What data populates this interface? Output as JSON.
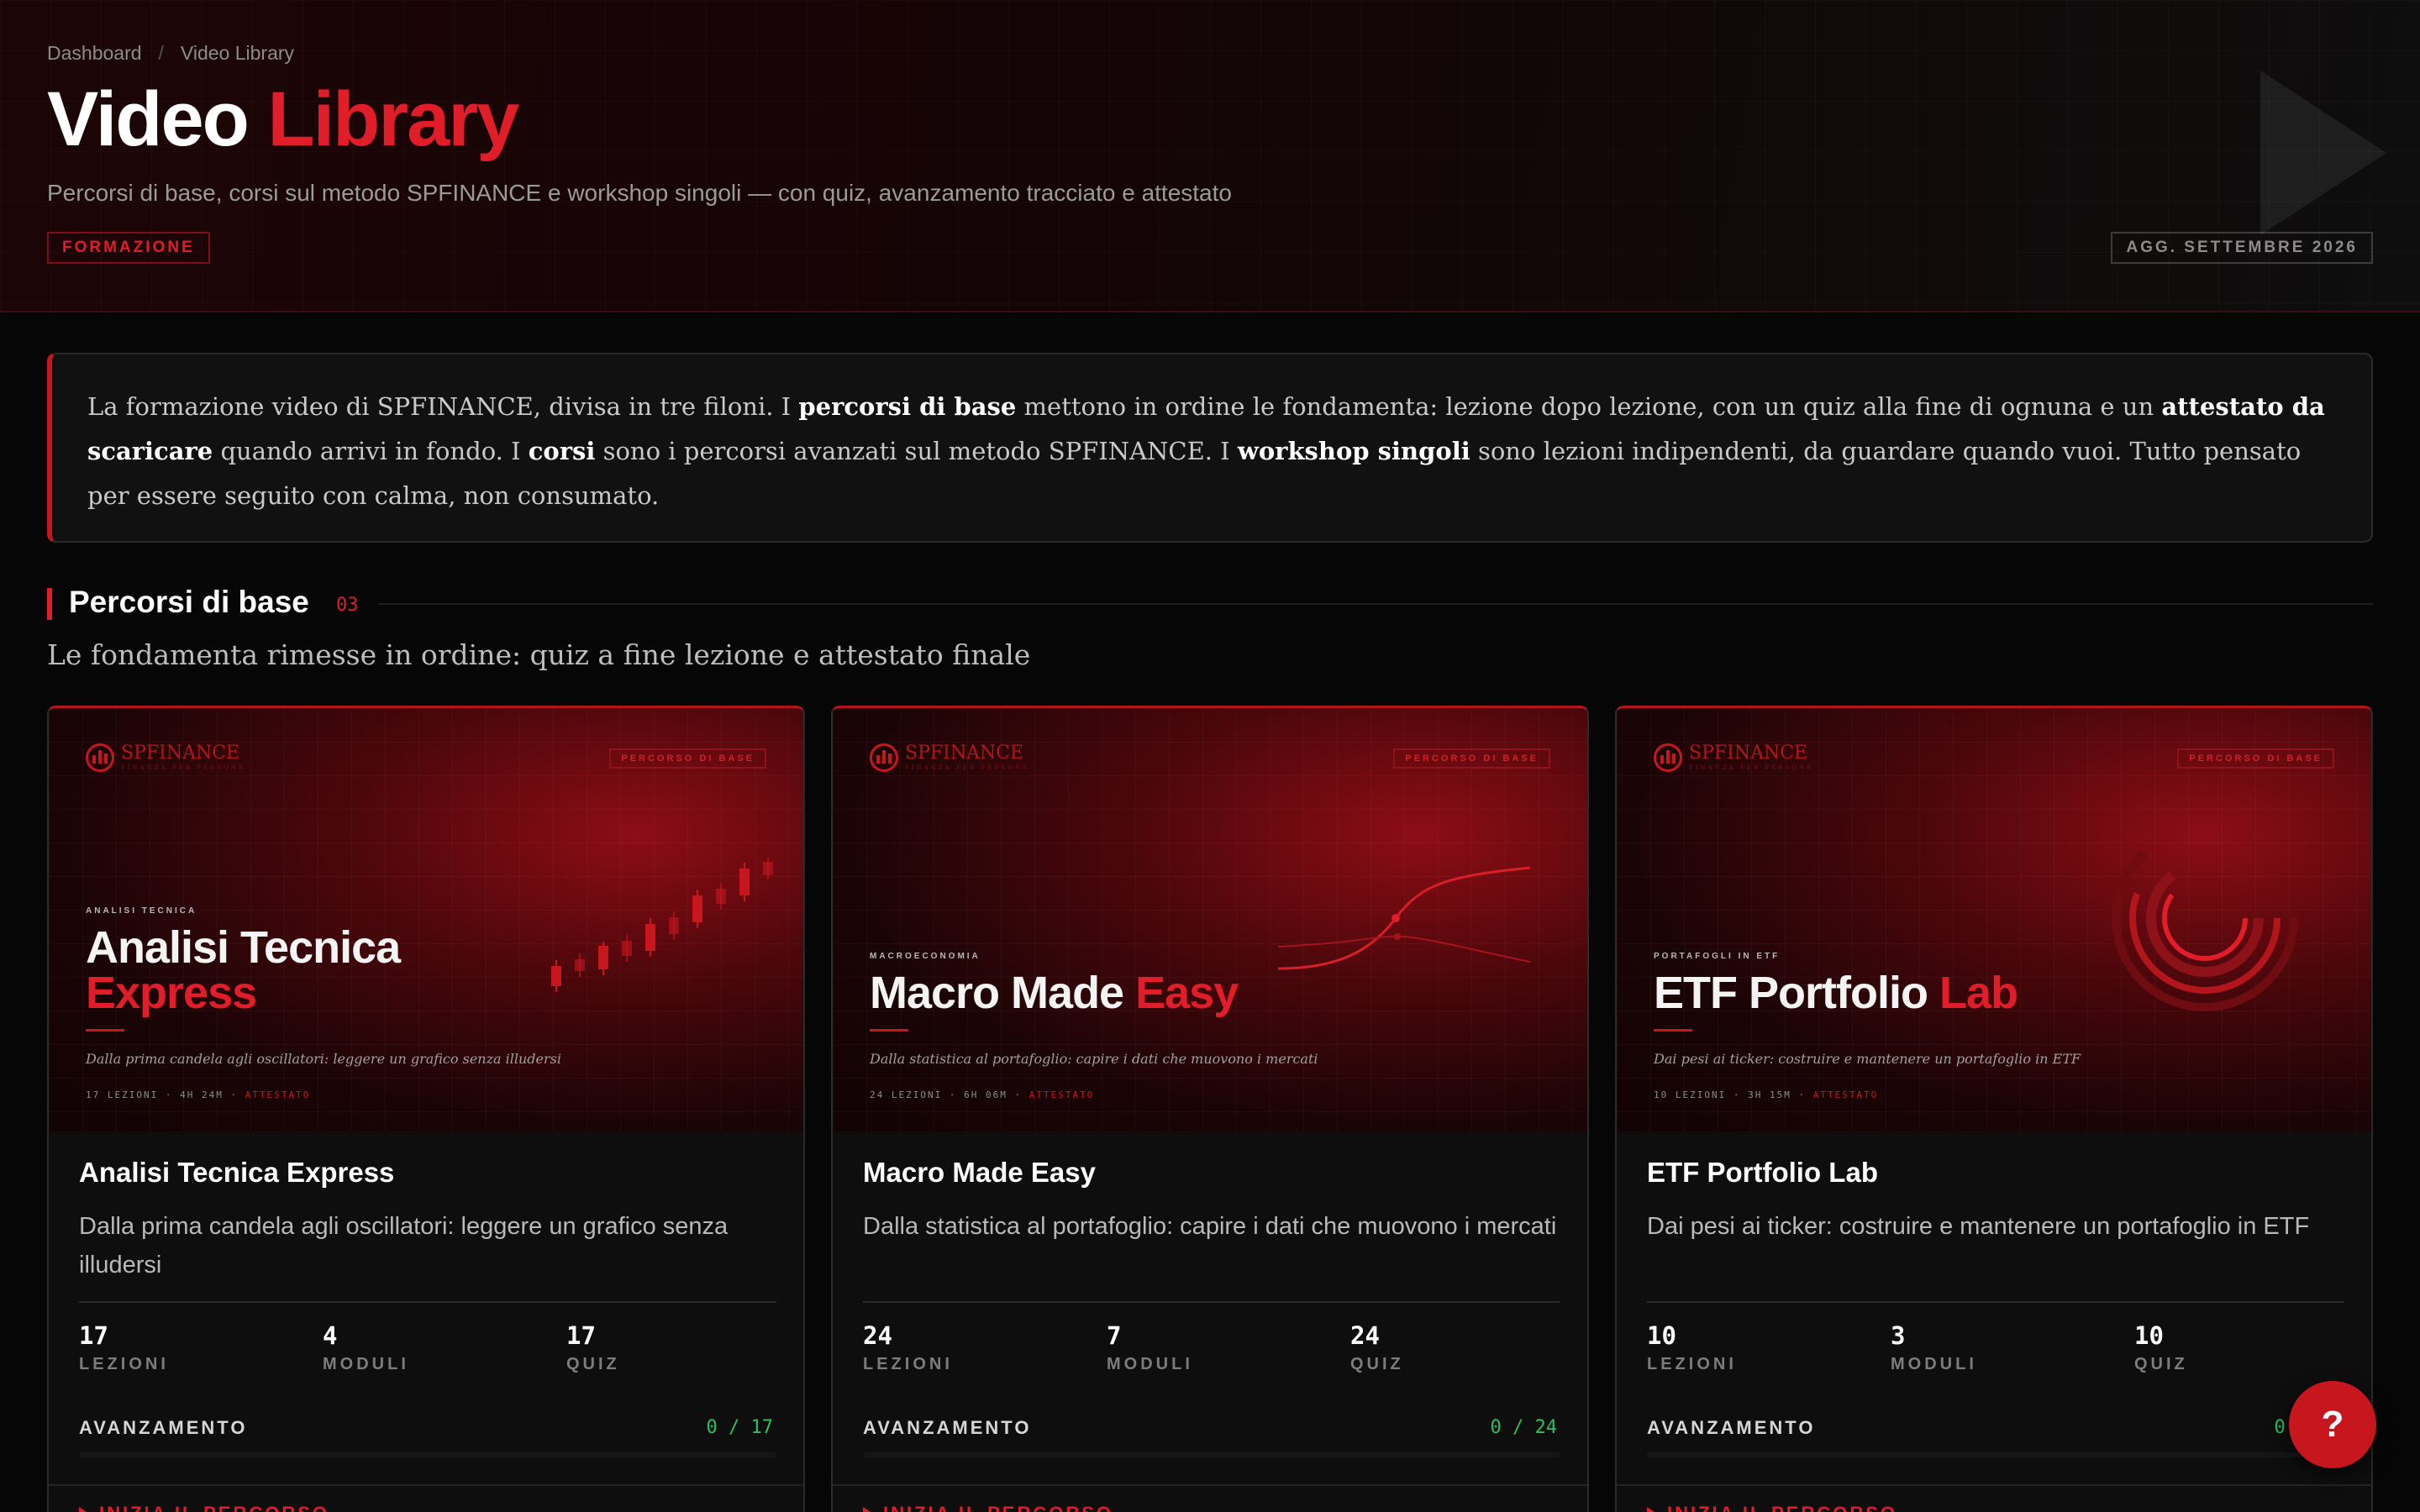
{
  "breadcrumb": {
    "home": "Dashboard",
    "separator": "/",
    "current": "Video Library"
  },
  "header": {
    "title_main": "Video",
    "title_accent": "Library",
    "subtitle": "Percorsi di base, corsi sul metodo SPFINANCE e workshop singoli — con quiz, avanzamento tracciato e attestato",
    "tag": "FORMAZIONE",
    "updated": "AGG. SETTEMBRE 2026",
    "watermark_icon": "play-icon"
  },
  "intro": {
    "p1": "La formazione video di SPFINANCE, divisa in tre filoni. I ",
    "b1": "percorsi di base",
    "p2": " mettono in ordine le fondamenta: lezione dopo lezione, con un quiz alla fine di ognuna e un ",
    "b2": "attestato da scaricare",
    "p3": " quando arrivi in fondo. I ",
    "b3": "corsi",
    "p4": " sono i percorsi avanzati sul metodo SPFINANCE. I ",
    "b4": "workshop singoli",
    "p5": " sono lezioni indipendenti, da guardare quando vuoi. Tutto pensato per essere seguito con calma, non consumato."
  },
  "section": {
    "title": "Percorsi di base",
    "count": "03",
    "subtitle": "Le fondamenta rimesse in ordine: quiz a fine lezione e attestato finale"
  },
  "labels": {
    "lessons": "LEZIONI",
    "modules": "MODULI",
    "quiz": "QUIZ",
    "progress": "AVANZAMENTO",
    "cta": "INIZIA IL PERCORSO"
  },
  "cards": [
    {
      "thumb": {
        "logo": "SPFINANCE",
        "logo_tagline": "FINANZA PER PERSONE",
        "tag": "PERCORSO DI BASE",
        "kicker": "ANALISI TECNICA",
        "title_main": "Analisi Tecnica",
        "title_accent": "Express",
        "desc": "Dalla prima candela agli oscillatori: leggere un grafico senza illudersi",
        "meta": "17 LEZIONI · 4H 24M · ",
        "meta_badge": "ATTESTATO"
      },
      "title": "Analisi Tecnica Express",
      "desc": "Dalla prima candela agli oscillatori: leggere un grafico senza illudersi",
      "lessons": "17",
      "modules": "4",
      "quiz": "17",
      "progress_text": "0 / 17",
      "progress": 0
    },
    {
      "thumb": {
        "logo": "SPFINANCE",
        "logo_tagline": "FINANZA PER PERSONE",
        "tag": "PERCORSO DI BASE",
        "kicker": "MACROECONOMIA",
        "title_main": "Macro Made",
        "title_accent": "Easy",
        "desc": "Dalla statistica al portafoglio: capire i dati che muovono i mercati",
        "meta": "24 LEZIONI · 6H 06M · ",
        "meta_badge": "ATTESTATO"
      },
      "title": "Macro Made Easy",
      "desc": "Dalla statistica al portafoglio: capire i dati che muovono i mercati",
      "lessons": "24",
      "modules": "7",
      "quiz": "24",
      "progress_text": "0 / 24",
      "progress": 0
    },
    {
      "thumb": {
        "logo": "SPFINANCE",
        "logo_tagline": "FINANZA PER PERSONE",
        "tag": "PERCORSO DI BASE",
        "kicker": "PORTAFOGLI IN ETF",
        "title_main": "ETF Portfolio",
        "title_accent": "Lab",
        "desc": "Dai pesi ai ticker: costruire e mantenere un portafoglio in ETF",
        "meta": "10 LEZIONI · 3H 15M · ",
        "meta_badge": "ATTESTATO"
      },
      "title": "ETF Portfolio Lab",
      "desc": "Dai pesi ai ticker: costruire e mantenere un portafoglio in ETF",
      "lessons": "10",
      "modules": "3",
      "quiz": "10",
      "progress_text": "0 / 10",
      "progress": 0
    }
  ],
  "help": {
    "label": "?",
    "icon": "help-icon"
  },
  "colors": {
    "accent": "#e11d2a",
    "progress": "#28c25c",
    "background": "#060606"
  }
}
